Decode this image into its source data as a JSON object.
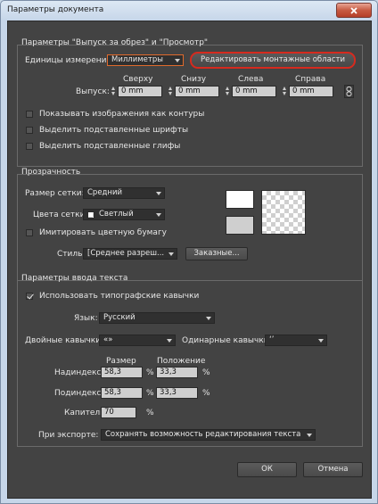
{
  "window": {
    "title": "Параметры документа"
  },
  "bleed_group": {
    "title": "Параметры \"Выпуск за обрез\" и \"Просмотр\"",
    "units_label": "Единицы измерения:",
    "units_value": "Миллиметры",
    "edit_artboards_label": "Редактировать монтажные области",
    "bleed_label": "Выпуск:",
    "columns": [
      {
        "header": "Сверху",
        "value": "0 mm"
      },
      {
        "header": "Снизу",
        "value": "0 mm"
      },
      {
        "header": "Слева",
        "value": "0 mm"
      },
      {
        "header": "Справа",
        "value": "0 mm"
      }
    ],
    "checkboxes": [
      {
        "label": "Показывать изображения как контуры",
        "checked": false
      },
      {
        "label": "Выделить подставленные шрифты",
        "checked": false
      },
      {
        "label": "Выделить подставленные глифы",
        "checked": false
      }
    ]
  },
  "transparency_group": {
    "title": "Прозрачность",
    "grid_size_label": "Размер сетки:",
    "grid_size_value": "Средний",
    "grid_colors_label": "Цвета сетки:",
    "grid_colors_value": "Светлый",
    "simulate_paper_label": "Имитировать цветную бумагу",
    "style_label": "Стиль:",
    "style_value": "[Среднее разреш...",
    "custom_button": "Заказные..."
  },
  "text_group": {
    "title": "Параметры ввода текста",
    "typographic_quotes_label": "Использовать типографские кавычки",
    "typographic_quotes_checked": true,
    "language_label": "Язык:",
    "language_value": "Русский",
    "double_quotes_label": "Двойные кавычки:",
    "double_quotes_value": "«»",
    "single_quotes_label": "Одинарные кавычки:",
    "single_quotes_value": "‘’",
    "size_header": "Размер",
    "position_header": "Положение",
    "superscript_label": "Надиндекс:",
    "superscript_size": "58,3",
    "superscript_position": "33,3",
    "subscript_label": "Подиндекс:",
    "subscript_size": "58,3",
    "subscript_position": "33,3",
    "smallcaps_label": "Капители:",
    "smallcaps_value": "70",
    "percent": "%",
    "export_label": "При экспорте:",
    "export_value": "Сохранять возможность редактирования текста"
  },
  "footer": {
    "ok_label": "ОК",
    "cancel_label": "Отмена"
  },
  "colors": {
    "highlight": "#d62a1e",
    "dialog_bg": "#434343"
  }
}
